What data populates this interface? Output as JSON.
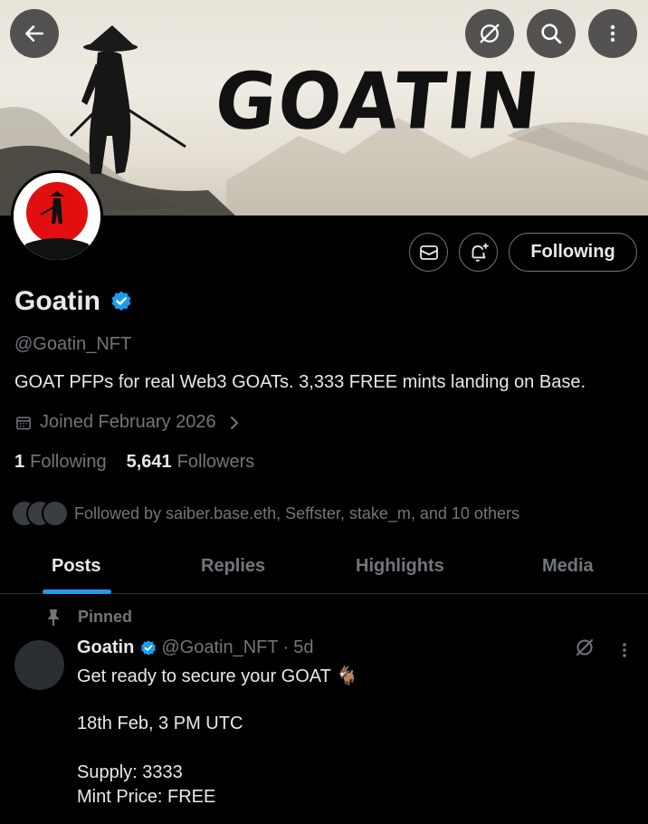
{
  "banner": {
    "title": "GOATIN"
  },
  "top_actions": {
    "back_icon": "arrow-left-icon",
    "grok_icon": "grok-icon",
    "search_icon": "search-icon",
    "more_icon": "more-vertical-icon"
  },
  "profile": {
    "name": "Goatin",
    "handle": "@Goatin_NFT",
    "bio": "GOAT PFPs for real Web3 GOATs.  3,333 FREE mints landing on Base.",
    "joined": "Joined February 2026",
    "following_count": "1",
    "following_label": "Following",
    "followers_count": "5,641",
    "followers_label": "Followers",
    "followed_by": "Followed by saiber.base.eth, Seffster, stake_m, and 10 others",
    "follow_button": "Following",
    "verified_color": "#1d9bf0"
  },
  "tabs": [
    {
      "label": "Posts",
      "active": true
    },
    {
      "label": "Replies",
      "active": false
    },
    {
      "label": "Highlights",
      "active": false
    },
    {
      "label": "Media",
      "active": false
    }
  ],
  "post": {
    "pinned_label": "Pinned",
    "author": "Goatin",
    "handle": "@Goatin_NFT",
    "separator": "·",
    "time": "5d",
    "line1": "Get ready to secure your GOAT 🐐",
    "line2": "18th Feb, 3 PM UTC",
    "line3": "Supply: 3333",
    "line4": "Mint Price: FREE"
  },
  "colors": {
    "accent": "#1d9bf0",
    "muted": "#71767b",
    "text": "#e7e9ea",
    "background": "#000000"
  }
}
